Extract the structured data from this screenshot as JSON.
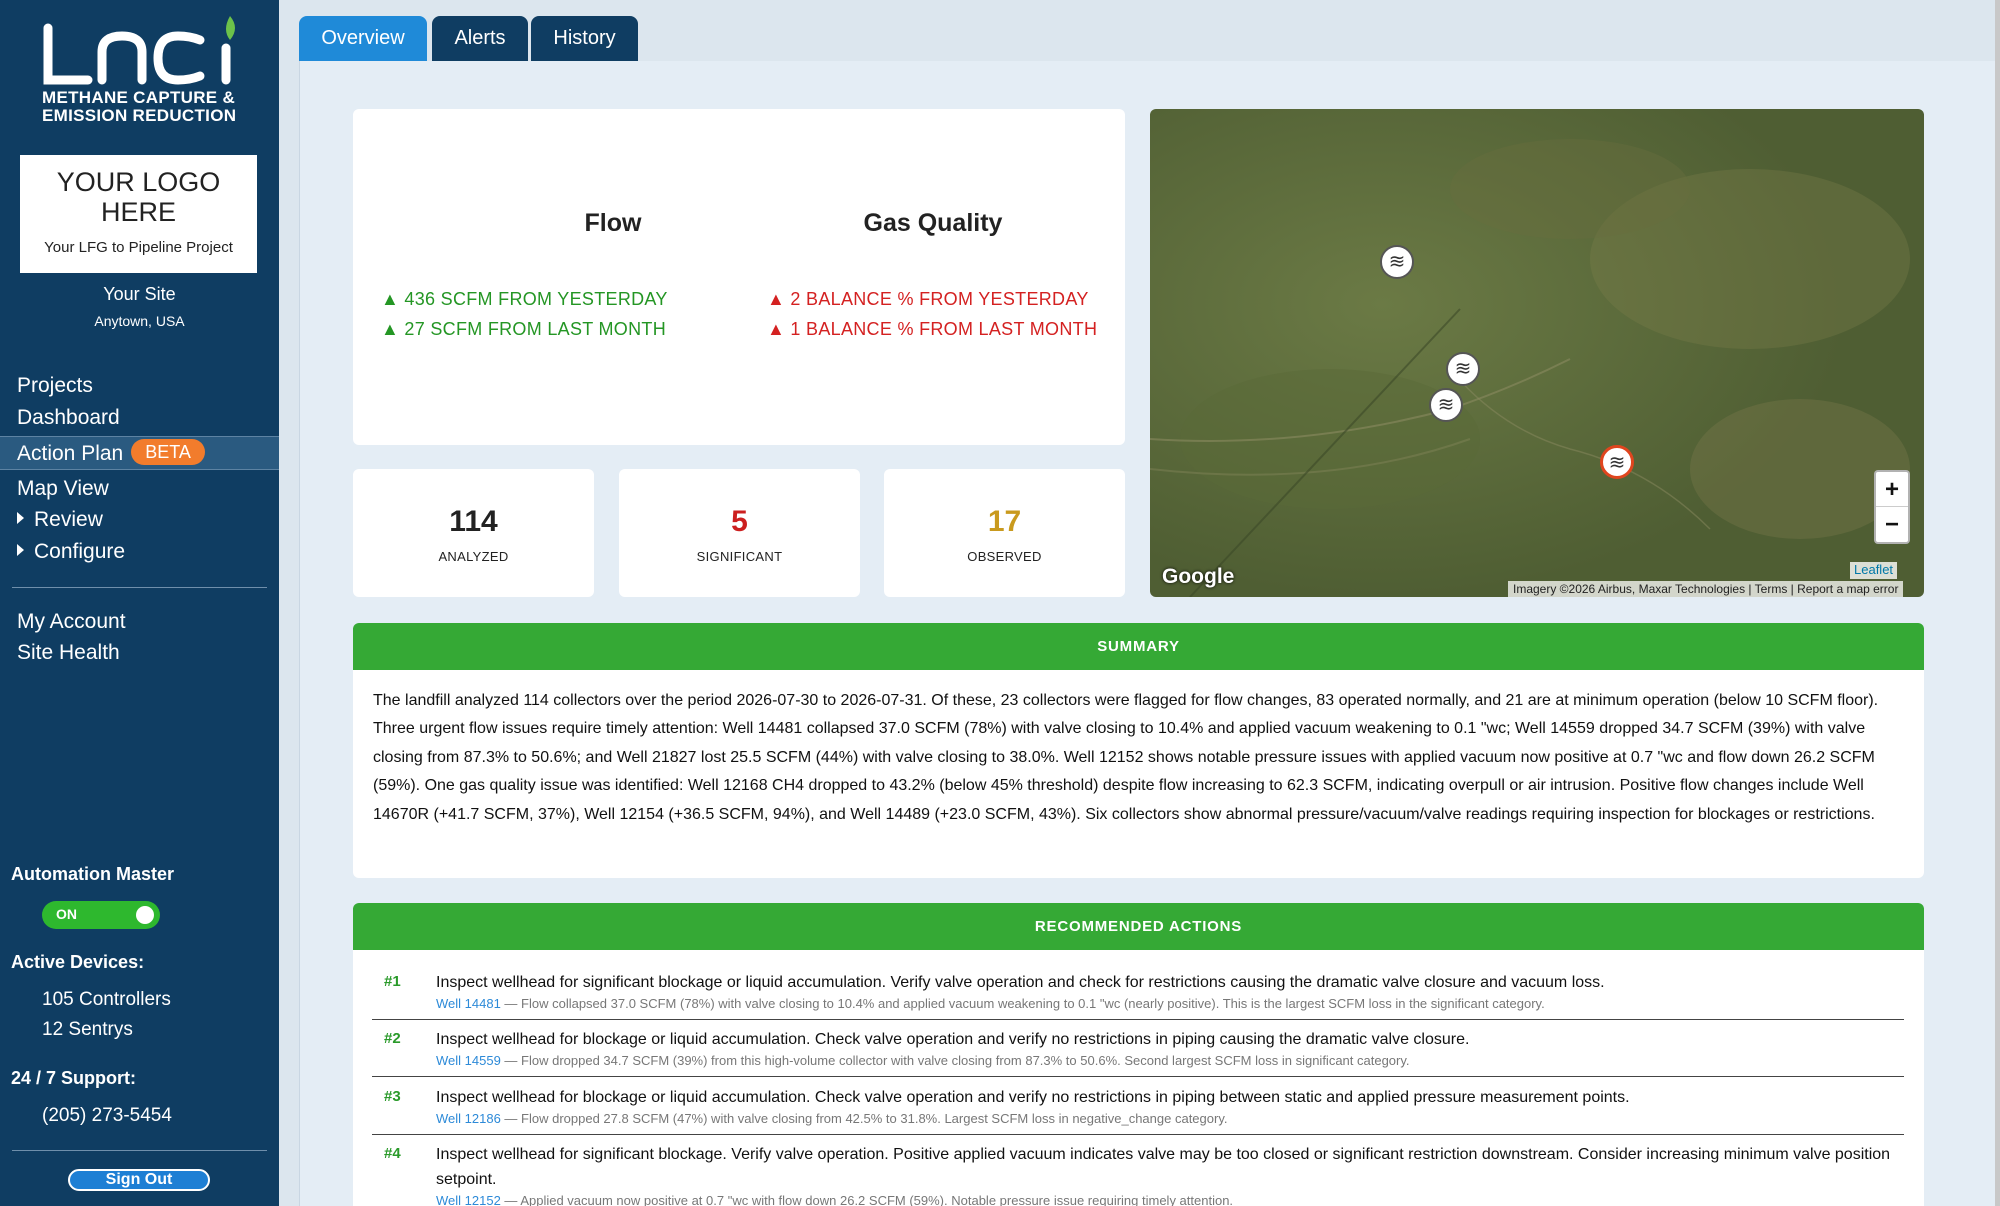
{
  "sidebar": {
    "brand": {
      "line1": "METHANE CAPTURE &",
      "line2": "EMISSION REDUCTION"
    },
    "placeholder": {
      "title_line1": "YOUR LOGO",
      "title_line2": "HERE",
      "subtitle": "Your LFG to Pipeline Project"
    },
    "site": {
      "name": "Your Site",
      "location": "Anytown, USA"
    },
    "nav": {
      "projects": "Projects",
      "dashboard": "Dashboard",
      "action_plan": "Action Plan",
      "beta": "BETA",
      "map_view": "Map View",
      "review": "Review",
      "configure": "Configure",
      "my_account": "My Account",
      "site_health": "Site Health"
    },
    "automation": {
      "heading": "Automation Master",
      "toggle": "ON"
    },
    "devices": {
      "heading": "Active Devices:",
      "controllers": "105 Controllers",
      "sentrys": "12 Sentrys"
    },
    "support": {
      "heading": "24 / 7 Support:",
      "phone": "(205) 273-5454"
    },
    "sign_out": "Sign Out"
  },
  "tabs": {
    "overview": "Overview",
    "alerts": "Alerts",
    "history": "History"
  },
  "kpi": {
    "flow": {
      "heading": "Flow",
      "line1": "▲ 436 SCFM FROM YESTERDAY",
      "line2": "▲ 27 SCFM FROM LAST MONTH"
    },
    "gas_quality": {
      "heading": "Gas Quality",
      "line1": "▲ 2 BALANCE % FROM YESTERDAY",
      "line2": "▲ 1 BALANCE % FROM LAST MONTH"
    }
  },
  "stats": {
    "analyzed": {
      "value": "114",
      "label": "ANALYZED",
      "color": "#222222"
    },
    "significant": {
      "value": "5",
      "label": "SIGNIFICANT",
      "color": "#cc1f1f"
    },
    "observed": {
      "value": "17",
      "label": "OBSERVED",
      "color": "#c99a1e"
    }
  },
  "map": {
    "zoom_in": "+",
    "zoom_out": "−",
    "google": "Google",
    "attribution": "Imagery ©2026 Airbus, Maxar Technologies  |  Terms  |  Report a map error",
    "leaflet": "Leaflet",
    "marker_icon": "wind-icon"
  },
  "summary": {
    "heading": "SUMMARY",
    "text": "The landfill analyzed 114 collectors over the period 2026-07-30 to 2026-07-31. Of these, 23 collectors were flagged for flow changes, 83 operated normally, and 21 are at minimum operation (below 10 SCFM floor). Three urgent flow issues require timely attention: Well 14481 collapsed 37.0 SCFM (78%) with valve closing to 10.4% and applied vacuum weakening to 0.1 \"wc; Well 14559 dropped 34.7 SCFM (39%) with valve closing from 87.3% to 50.6%; and Well 21827 lost 25.5 SCFM (44%) with valve closing to 38.0%. Well 12152 shows notable pressure issues with applied vacuum now positive at 0.7 \"wc and flow down 26.2 SCFM (59%). One gas quality issue was identified: Well 12168 CH4 dropped to 43.2% (below 45% threshold) despite flow increasing to 62.3 SCFM, indicating overpull or air intrusion. Positive flow changes include Well 14670R (+41.7 SCFM, 37%), Well 12154 (+36.5 SCFM, 94%), and Well 14489 (+23.0 SCFM, 43%). Six collectors show abnormal pressure/vacuum/valve readings requiring inspection for blockages or restrictions."
  },
  "actions": {
    "heading": "RECOMMENDED ACTIONS",
    "items": [
      {
        "num": "#1",
        "text": "Inspect wellhead for significant blockage or liquid accumulation. Verify valve operation and check for restrictions causing the dramatic valve closure and vacuum loss.",
        "well": "Well 14481",
        "detail": " — Flow collapsed 37.0 SCFM (78%) with valve closing to 10.4% and applied vacuum weakening to 0.1 \"wc (nearly positive). This is the largest SCFM loss in the significant category."
      },
      {
        "num": "#2",
        "text": "Inspect wellhead for blockage or liquid accumulation. Check valve operation and verify no restrictions in piping causing the dramatic valve closure.",
        "well": "Well 14559",
        "detail": " — Flow dropped 34.7 SCFM (39%) from this high-volume collector with valve closing from 87.3% to 50.6%. Second largest SCFM loss in significant category."
      },
      {
        "num": "#3",
        "text": "Inspect wellhead for blockage or liquid accumulation. Check valve operation and verify no restrictions in piping between static and applied pressure measurement points.",
        "well": "Well 12186",
        "detail": " — Flow dropped 27.8 SCFM (47%) with valve closing from 42.5% to 31.8%. Largest SCFM loss in negative_change category."
      },
      {
        "num": "#4",
        "text": "Inspect wellhead for significant blockage. Verify valve operation. Positive applied vacuum indicates valve may be too closed or significant restriction downstream. Consider increasing minimum valve position setpoint.",
        "well": "Well 12152",
        "detail": " — Applied vacuum now positive at 0.7 \"wc with flow down 26.2 SCFM (59%). Notable pressure issue requiring timely attention."
      }
    ]
  }
}
